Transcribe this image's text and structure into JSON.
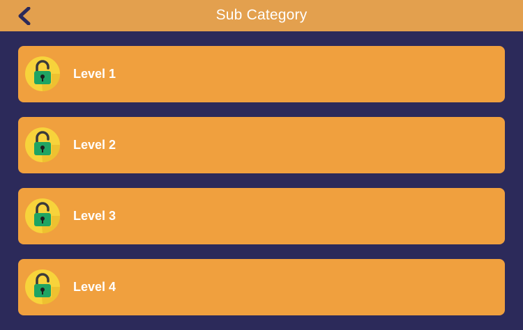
{
  "header": {
    "title": "Sub Category",
    "back_icon": "chevron-left-icon"
  },
  "levels": [
    {
      "label": "Level 1",
      "icon": "unlocked-padlock-icon"
    },
    {
      "label": "Level 2",
      "icon": "unlocked-padlock-icon"
    },
    {
      "label": "Level 3",
      "icon": "unlocked-padlock-icon"
    },
    {
      "label": "Level 4",
      "icon": "unlocked-padlock-icon"
    }
  ],
  "colors": {
    "background": "#2c2a5a",
    "header": "#e3a04e",
    "card": "#f0a03e",
    "badge": "#f7d33b",
    "lock_body": "#1fa463",
    "back_arrow": "#2c2a5a"
  }
}
